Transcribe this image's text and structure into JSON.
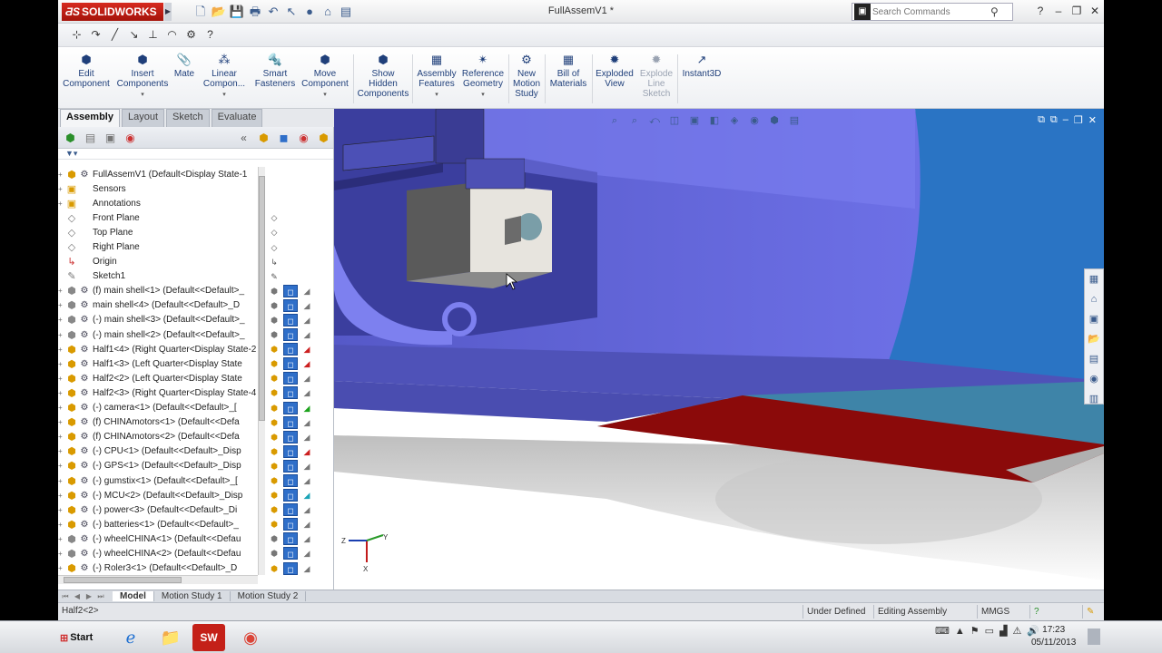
{
  "app": {
    "brand": "SOLIDWORKS",
    "document_title": "FullAssemV1 *",
    "search_placeholder": "Search Commands"
  },
  "commands": [
    {
      "label_line1": "Edit",
      "label_line2": "Component",
      "icon": "edit-component-icon"
    },
    {
      "label_line1": "Insert",
      "label_line2": "Components",
      "icon": "insert-components-icon"
    },
    {
      "label_line1": "Mate",
      "label_line2": "",
      "icon": "mate-icon"
    },
    {
      "label_line1": "Linear",
      "label_line2": "Compon...",
      "icon": "linear-pattern-icon"
    },
    {
      "label_line1": "Smart",
      "label_line2": "Fasteners",
      "icon": "smart-fasteners-icon"
    },
    {
      "label_line1": "Move",
      "label_line2": "Component",
      "icon": "move-component-icon"
    },
    {
      "label_line1": "Show",
      "label_line2": "Hidden",
      "label_line3": "Components",
      "icon": "show-hidden-icon"
    },
    {
      "label_line1": "Assembly",
      "label_line2": "Features",
      "icon": "assembly-features-icon"
    },
    {
      "label_line1": "Reference",
      "label_line2": "Geometry",
      "icon": "reference-geometry-icon"
    },
    {
      "label_line1": "New",
      "label_line2": "Motion",
      "label_line3": "Study",
      "icon": "motion-study-icon"
    },
    {
      "label_line1": "Bill of",
      "label_line2": "Materials",
      "icon": "bom-icon"
    },
    {
      "label_line1": "Exploded",
      "label_line2": "View",
      "icon": "exploded-view-icon"
    },
    {
      "label_line1": "Explode",
      "label_line2": "Line",
      "label_line3": "Sketch",
      "icon": "explode-line-icon"
    },
    {
      "label_line1": "Instant3D",
      "label_line2": "",
      "icon": "instant3d-icon"
    }
  ],
  "cm_tabs": [
    "Assembly",
    "Layout",
    "Sketch",
    "Evaluate"
  ],
  "tree": [
    {
      "label": "FullAssemV1  (Default<Display State-1",
      "type": "root"
    },
    {
      "label": "Sensors",
      "type": "folder"
    },
    {
      "label": "Annotations",
      "type": "folder"
    },
    {
      "label": "Front Plane",
      "type": "plane"
    },
    {
      "label": "Top Plane",
      "type": "plane"
    },
    {
      "label": "Right Plane",
      "type": "plane"
    },
    {
      "label": "Origin",
      "type": "origin"
    },
    {
      "label": "Sketch1",
      "type": "sketch"
    },
    {
      "label": "(f) main shell<1> (Default<<Default>_",
      "type": "part"
    },
    {
      "label": "main shell<4> (Default<<Default>_D",
      "type": "part"
    },
    {
      "label": "(-) main shell<3> (Default<<Default>_",
      "type": "part"
    },
    {
      "label": "(-) main shell<2> (Default<<Default>_",
      "type": "part"
    },
    {
      "label": "Half1<4> (Right Quarter<Display State-2",
      "type": "asm"
    },
    {
      "label": "Half1<3> (Left Quarter<Display State",
      "type": "asm"
    },
    {
      "label": "Half2<2> (Left Quarter<Display State",
      "type": "asm"
    },
    {
      "label": "Half2<3> (Right Quarter<Display State-4",
      "type": "asm"
    },
    {
      "label": "(-) camera<1> (Default<<Default>_[",
      "type": "asm"
    },
    {
      "label": "(f) CHINAmotors<1> (Default<<Defa",
      "type": "asm"
    },
    {
      "label": "(f) CHINAmotors<2> (Default<<Defa",
      "type": "asm"
    },
    {
      "label": "(-) CPU<1> (Default<<Default>_Disp",
      "type": "asm"
    },
    {
      "label": "(-) GPS<1> (Default<<Default>_Disp",
      "type": "asm"
    },
    {
      "label": "(-) gumstix<1> (Default<<Default>_[",
      "type": "asm"
    },
    {
      "label": "(-) MCU<2> (Default<<Default>_Disp",
      "type": "asm"
    },
    {
      "label": "(-) power<3> (Default<<Default>_Di",
      "type": "asm"
    },
    {
      "label": "(-) batteries<1> (Default<<Default>_",
      "type": "asm"
    },
    {
      "label": "(-) wheelCHINA<1> (Default<<Defau",
      "type": "part"
    },
    {
      "label": "(-) wheelCHINA<2> (Default<<Defau",
      "type": "part"
    },
    {
      "label": "(-) Roler3<1> (Default<<Default>_D",
      "type": "asm"
    }
  ],
  "tree_cols": [
    "",
    "",
    "",
    "",
    "",
    "",
    "",
    "",
    "gray",
    "gray",
    "gray",
    "gray",
    "red",
    "red",
    "gray",
    "gray",
    "grn",
    "gray",
    "gray",
    "red",
    "gray",
    "gray",
    "cy",
    "gray",
    "gray",
    "gray",
    "gray",
    "gray"
  ],
  "bottom_tabs": [
    "Model",
    "Motion Study 1",
    "Motion Study 2"
  ],
  "status": {
    "selection": "Half2<2>",
    "definition": "Under Defined",
    "mode": "Editing Assembly",
    "units": "MMGS"
  },
  "taskbar": {
    "start_label": "Start",
    "time": "17:23",
    "date": "05/11/2013"
  },
  "triad": {
    "y": "Y",
    "z": "Z",
    "x": "X"
  }
}
